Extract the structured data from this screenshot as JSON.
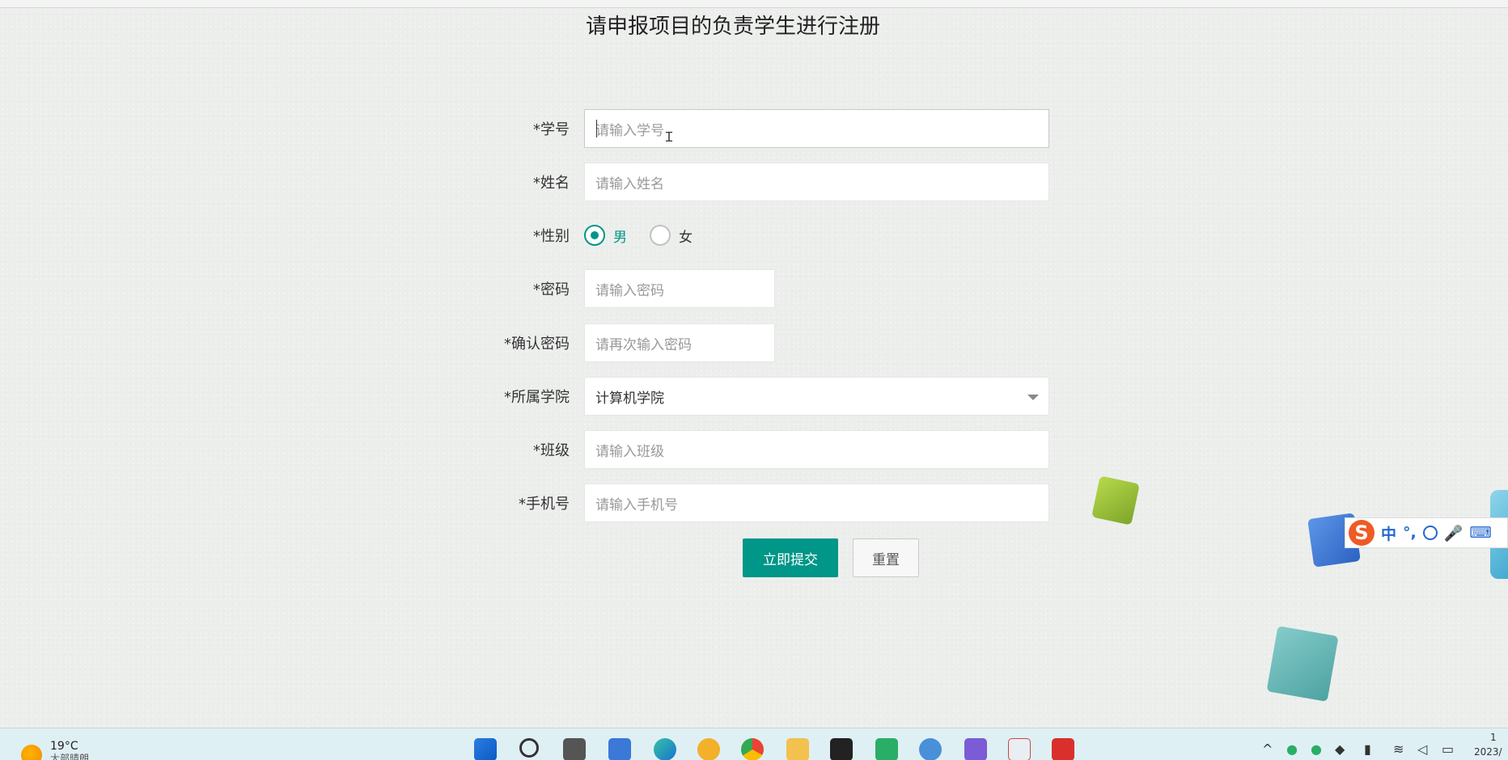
{
  "page": {
    "title": "请申报项目的负责学生进行注册"
  },
  "form": {
    "fields": [
      {
        "label": "*学号",
        "placeholder": "请输入学号"
      },
      {
        "label": "*姓名",
        "placeholder": "请输入姓名"
      },
      {
        "label": "*性别",
        "options": [
          "男",
          "女"
        ],
        "selected": "男"
      },
      {
        "label": "*密码",
        "placeholder": "请输入密码"
      },
      {
        "label": "*确认密码",
        "placeholder": "请再次输入密码"
      },
      {
        "label": "*所属学院",
        "value": "计算机学院"
      },
      {
        "label": "*班级",
        "placeholder": "请输入班级"
      },
      {
        "label": "*手机号",
        "placeholder": "请输入手机号"
      }
    ],
    "submit_label": "立即提交",
    "reset_label": "重置"
  },
  "ime_toolbar": {
    "mode": "中",
    "punct": "°,"
  },
  "taskbar": {
    "weather": {
      "temp": "19°C",
      "desc": "大部晴朗"
    },
    "icons": [
      "windows-start-icon",
      "search-icon",
      "task-view-icon",
      "app-icon",
      "edge-icon",
      "ie-icon",
      "chrome-icon",
      "file-explorer-icon",
      "jetbrains-icon",
      "wechat-icon",
      "app-icon",
      "app-icon",
      "app-icon",
      "wps-icon"
    ],
    "clock": "1",
    "date": "2023/"
  },
  "colors": {
    "primary": "#009688",
    "taskbar": "#dff0f4"
  }
}
